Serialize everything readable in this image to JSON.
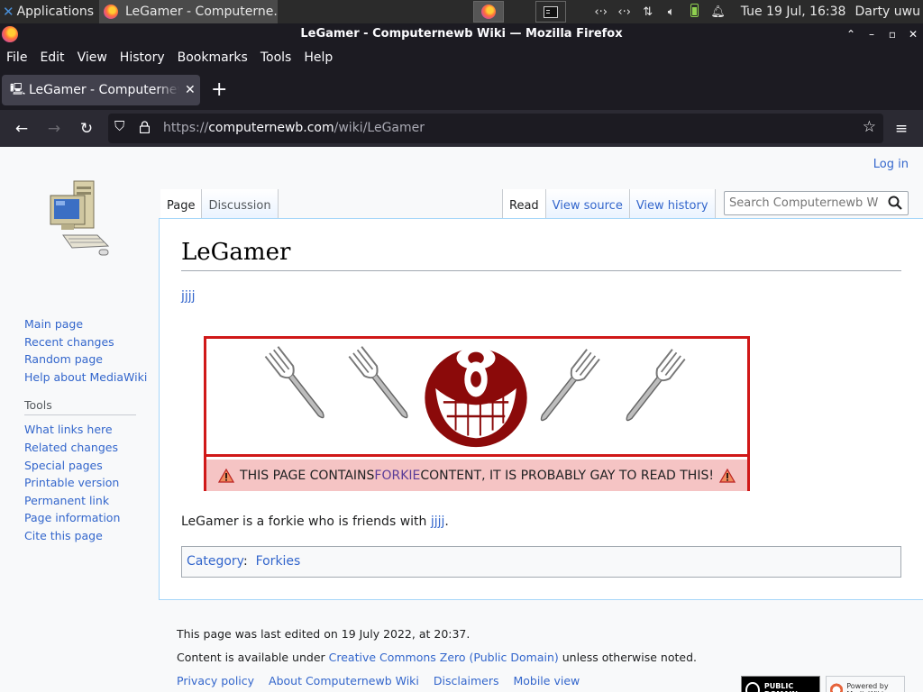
{
  "os_panel": {
    "applications_label": "Applications",
    "task_title": "LeGamer - Computerne...",
    "clock": "Tue 19 Jul, 16:38",
    "user": "Darty uwu",
    "tray_icons": [
      "network-icon",
      "network-icon",
      "updown-icon",
      "volume-icon",
      "battery-icon",
      "bell-icon"
    ]
  },
  "window": {
    "title": "LeGamer - Computernewb Wiki — Mozilla Firefox"
  },
  "menubar": [
    "File",
    "Edit",
    "View",
    "History",
    "Bookmarks",
    "Tools",
    "Help"
  ],
  "browser": {
    "tab_title": "LeGamer - Computernewb Wiki",
    "url_domain": "https://",
    "url_host": "computernewb.com",
    "url_path": "/wiki/LeGamer"
  },
  "wiki": {
    "login": "Log in",
    "tabs_left": [
      "Page",
      "Discussion"
    ],
    "tabs_right": [
      "Read",
      "View source",
      "View history"
    ],
    "search_placeholder": "Search Computernewb Wiki",
    "sidebar_nav": [
      "Main page",
      "Recent changes",
      "Random page",
      "Help about MediaWiki"
    ],
    "tools_heading": "Tools",
    "tools": [
      "What links here",
      "Related changes",
      "Special pages",
      "Printable version",
      "Permanent link",
      "Page information",
      "Cite this page"
    ],
    "page_title": "LeGamer",
    "top_link": "jjjj",
    "banner": {
      "pre": "THIS PAGE CONTAINS ",
      "link": "FORKIE",
      "post": " CONTENT, IT IS PROBABLY GAY TO READ THIS!"
    },
    "body": {
      "pre": "LeGamer is a forkie who is friends with ",
      "link": "jjjj",
      "post": "."
    },
    "category_label": "Category",
    "category_sep": ":",
    "category_value": "Forkies",
    "footer": {
      "edited": "This page was last edited on 19 July 2022, at 20:37.",
      "license_pre": "Content is available under ",
      "license_link": "Creative Commons Zero (Public Domain)",
      "license_post": " unless otherwise noted.",
      "links": [
        "Privacy policy",
        "About Computernewb Wiki",
        "Disclaimers",
        "Mobile view"
      ],
      "badge_pd": "PUBLIC DOMAIN",
      "badge_mw": "Powered by MediaWiki"
    }
  },
  "colors": {
    "link": "#3366cc",
    "banner_border": "#d01818",
    "banner_bg": "#f5c4c4",
    "smiley": "#8b0a0a"
  }
}
